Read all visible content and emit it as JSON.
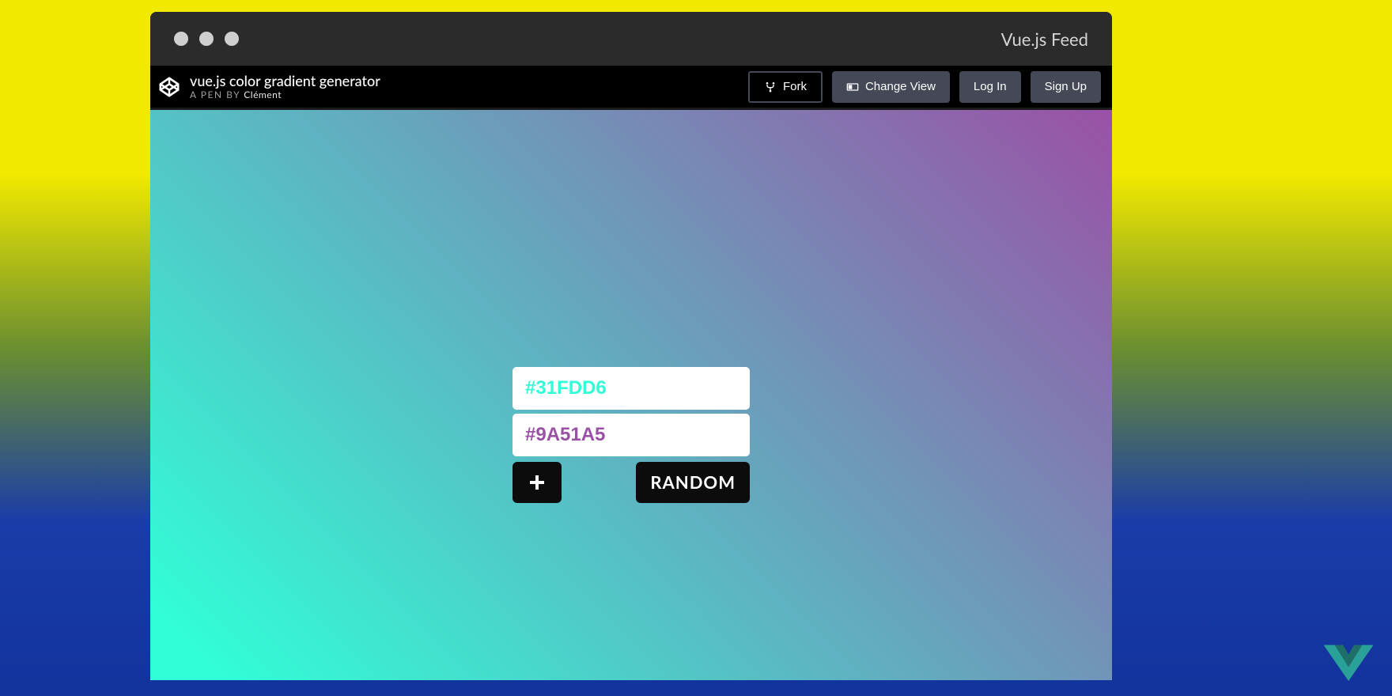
{
  "browser": {
    "site_title": "Vue.js Feed"
  },
  "codepen": {
    "pen_title": "vue.js color gradient generator",
    "byline_prefix": "A PEN BY ",
    "author": "Clément",
    "buttons": {
      "fork": "Fork",
      "change_view": "Change View",
      "log_in": "Log In",
      "sign_up": "Sign Up"
    }
  },
  "app": {
    "colors": [
      {
        "value": "#31FDD6",
        "text_color": "#31FDD6",
        "locked": false
      },
      {
        "value": "#9A51A5",
        "text_color": "#9A51A5",
        "locked": false
      }
    ],
    "random_label": "RANDOM",
    "gradient": {
      "from": "#31FDD6",
      "to": "#9A51A5"
    }
  }
}
